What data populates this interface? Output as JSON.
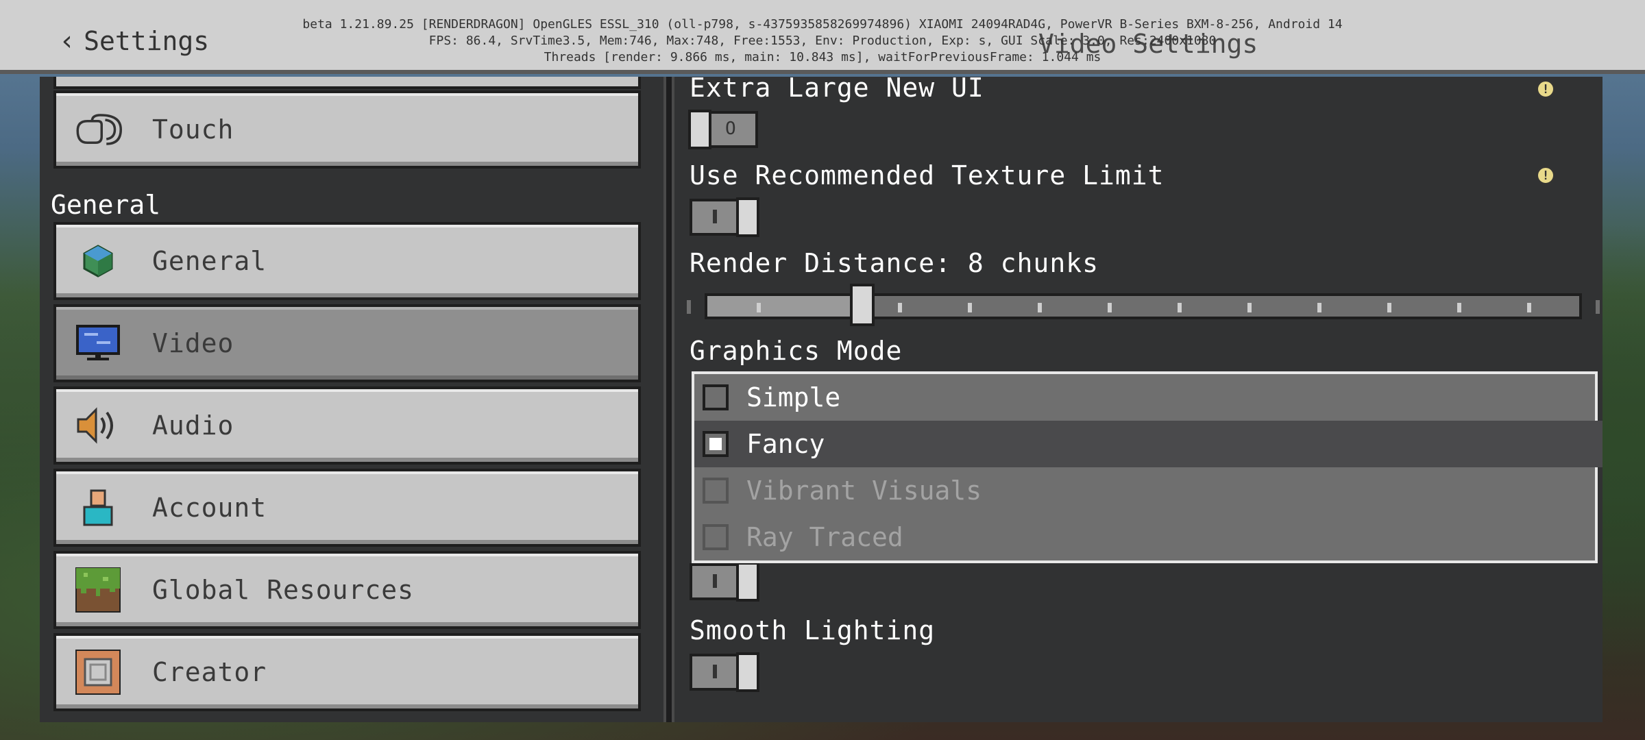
{
  "header": {
    "back_label": "Settings",
    "title": "Video Settings",
    "debug_lines": [
      "beta 1.21.89.25 [RENDERDRAGON] OpenGLES ESSL_310 (oll-p798, s-4375935858269974896) XIAOMI 24094RAD4G, PowerVR B-Series BXM-8-256, Android 14",
      "FPS: 86.4, SrvTime3.5, Mem:746, Max:748, Free:1553, Env: Production, Exp: s, GUI Scale: 3.0, Res:2400x1080",
      "Threads [render: 9.866 ms, main: 10.843 ms], waitForPreviousFrame: 1.044 ms"
    ]
  },
  "sidebar": {
    "section_general": "General",
    "items": [
      {
        "label": "Touch",
        "icon": "touch-icon",
        "active": false
      },
      {
        "label": "General",
        "icon": "globe-icon",
        "active": false
      },
      {
        "label": "Video",
        "icon": "monitor-icon",
        "active": true
      },
      {
        "label": "Audio",
        "icon": "speaker-icon",
        "active": false
      },
      {
        "label": "Account",
        "icon": "person-icon",
        "active": false
      },
      {
        "label": "Global Resources",
        "icon": "grass-block-icon",
        "active": false
      },
      {
        "label": "Creator",
        "icon": "command-block-icon",
        "active": false
      }
    ]
  },
  "settings": {
    "extra_large_ui": {
      "label": "Extra Large New UI",
      "value": "off"
    },
    "texture_limit": {
      "label": "Use Recommended Texture Limit",
      "value": "on"
    },
    "render_distance": {
      "label": "Render Distance: 8 chunks",
      "value": 8,
      "fraction": 0.18
    },
    "graphics_mode": {
      "label": "Graphics Mode",
      "options": [
        {
          "label": "Simple",
          "checked": false,
          "disabled": false
        },
        {
          "label": "Fancy",
          "checked": true,
          "disabled": false
        },
        {
          "label": "Vibrant Visuals",
          "checked": false,
          "disabled": true
        },
        {
          "label": "Ray Traced",
          "checked": false,
          "disabled": true
        }
      ]
    },
    "smooth_lighting": {
      "label": "Smooth Lighting",
      "value": "on"
    }
  },
  "colors": {
    "panel": "#313233",
    "button": "#c6c6c6",
    "button_active": "#8f8f8f",
    "info": "#e8d98a"
  }
}
